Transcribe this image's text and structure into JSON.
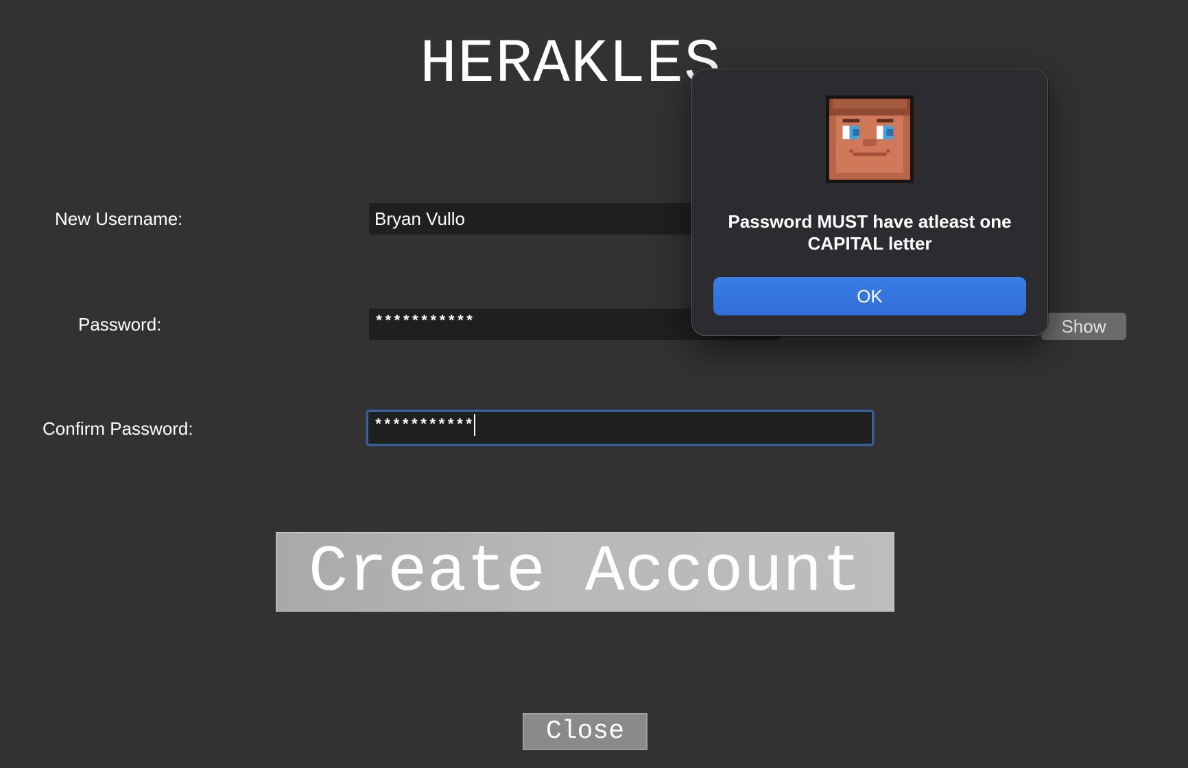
{
  "app": {
    "title": "HERAKLES"
  },
  "form": {
    "username_label": "New Username:",
    "username_value": "Bryan Vullo",
    "password_label": "Password:",
    "password_value": "***********",
    "show_label": "Show",
    "confirm_label": "Confirm Password:",
    "confirm_value": "***********",
    "create_label": "Create Account",
    "close_label": "Close"
  },
  "alert": {
    "icon": "pixel-face-icon",
    "message": "Password MUST have atleast one CAPITAL letter",
    "ok_label": "OK"
  },
  "colors": {
    "background": "#323232",
    "input_background": "#1f1f1f",
    "focus_ring": "#3c5f93",
    "dialog_background": "#2c2b30",
    "ok_button": "#3375df"
  }
}
